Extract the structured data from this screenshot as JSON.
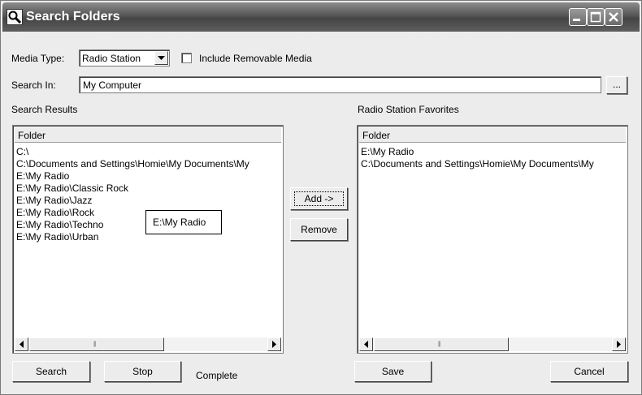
{
  "window": {
    "title": "Search Folders",
    "controls": {
      "minimize": "minimize-icon",
      "maximize": "maximize-icon",
      "close": "close-icon"
    }
  },
  "form": {
    "media_type_label": "Media Type:",
    "media_type_value": "Radio Station",
    "include_removable_label": "Include Removable Media",
    "include_removable_checked": false,
    "search_in_label": "Search In:",
    "search_in_value": "My Computer",
    "browse_label": "..."
  },
  "search_results": {
    "title": "Search Results",
    "column_header": "Folder",
    "rows": [
      "C:\\",
      "C:\\Documents and Settings\\Homie\\My Documents\\My",
      "E:\\My Radio",
      "E:\\My Radio\\Classic Rock",
      "E:\\My Radio\\Jazz",
      "E:\\My Radio\\Rock",
      "E:\\My Radio\\Techno",
      "E:\\My Radio\\Urban"
    ],
    "tooltip": "E:\\My Radio"
  },
  "favorites": {
    "title": "Radio Station Favorites",
    "column_header": "Folder",
    "rows": [
      "E:\\My Radio",
      "C:\\Documents and Settings\\Homie\\My Documents\\My"
    ]
  },
  "buttons": {
    "add": "Add ->",
    "remove": "Remove",
    "search": "Search",
    "stop": "Stop",
    "save": "Save",
    "cancel": "Cancel"
  },
  "status": "Complete",
  "colors": {
    "title_bar": "#4f4f4f",
    "face": "#ececec"
  }
}
